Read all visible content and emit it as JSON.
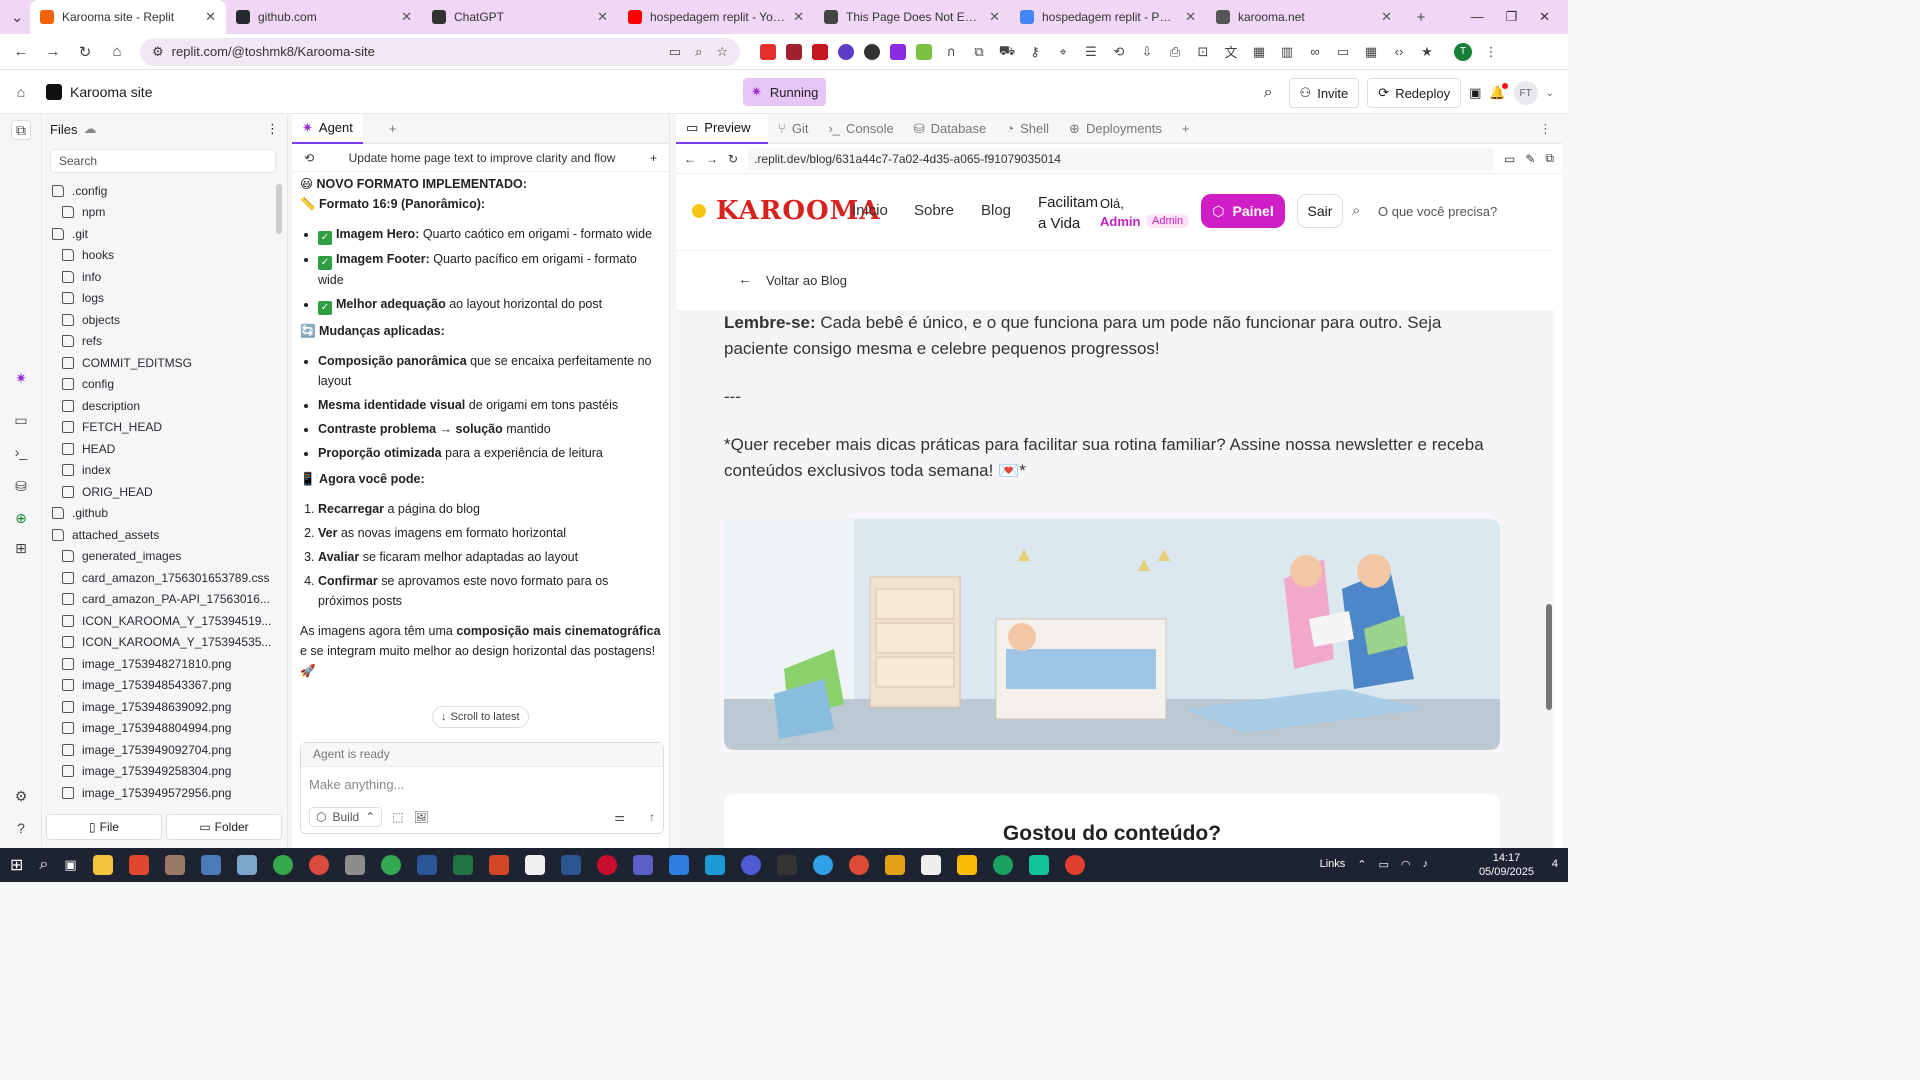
{
  "browser": {
    "tabs": [
      {
        "title": "Karooma site - Replit",
        "color": "#f26207"
      },
      {
        "title": "github.com",
        "color": "#24292f"
      },
      {
        "title": "ChatGPT",
        "color": "#333333"
      },
      {
        "title": "hospedagem replit - YouTube",
        "color": "#ff0000"
      },
      {
        "title": "This Page Does Not Exist",
        "color": "#444444"
      },
      {
        "title": "hospedagem replit - Pesquisa",
        "color": "#4285f4"
      },
      {
        "title": "karooma.net",
        "color": "#555555"
      }
    ],
    "url": "replit.com/@toshmk8/Karooma-site"
  },
  "app": {
    "project": "Karooma site",
    "running_label": "Running",
    "invite_label": "Invite",
    "redeploy_label": "Redeploy",
    "avatar_initials": "FT"
  },
  "files": {
    "title": "Files",
    "search_placeholder": "Search",
    "items": [
      {
        "name": ".config",
        "type": "folder",
        "depth": 0
      },
      {
        "name": "npm",
        "type": "folder",
        "depth": 1
      },
      {
        "name": ".git",
        "type": "folder",
        "depth": 0
      },
      {
        "name": "hooks",
        "type": "folder",
        "depth": 1
      },
      {
        "name": "info",
        "type": "folder",
        "depth": 1
      },
      {
        "name": "logs",
        "type": "folder",
        "depth": 1
      },
      {
        "name": "objects",
        "type": "folder",
        "depth": 1
      },
      {
        "name": "refs",
        "type": "folder",
        "depth": 1
      },
      {
        "name": "COMMIT_EDITMSG",
        "type": "file",
        "depth": 1
      },
      {
        "name": "config",
        "type": "file",
        "depth": 1
      },
      {
        "name": "description",
        "type": "file",
        "depth": 1
      },
      {
        "name": "FETCH_HEAD",
        "type": "file",
        "depth": 1
      },
      {
        "name": "HEAD",
        "type": "file",
        "depth": 1
      },
      {
        "name": "index",
        "type": "file",
        "depth": 1
      },
      {
        "name": "ORIG_HEAD",
        "type": "file",
        "depth": 1
      },
      {
        "name": ".github",
        "type": "folder",
        "depth": 0
      },
      {
        "name": "attached_assets",
        "type": "folder",
        "depth": 0
      },
      {
        "name": "generated_images",
        "type": "folder",
        "depth": 1
      },
      {
        "name": "card_amazon_1756301653789.css",
        "type": "file",
        "depth": 1
      },
      {
        "name": "card_amazon_PA-API_17563016...",
        "type": "file",
        "depth": 1
      },
      {
        "name": "ICON_KAROOMA_Y_175394519...",
        "type": "image",
        "depth": 1
      },
      {
        "name": "ICON_KAROOMA_Y_175394535...",
        "type": "image",
        "depth": 1
      },
      {
        "name": "image_1753948271810.png",
        "type": "image",
        "depth": 1
      },
      {
        "name": "image_1753948543367.png",
        "type": "image",
        "depth": 1
      },
      {
        "name": "image_1753948639092.png",
        "type": "image",
        "depth": 1
      },
      {
        "name": "image_1753948804994.png",
        "type": "image",
        "depth": 1
      },
      {
        "name": "image_1753949092704.png",
        "type": "image",
        "depth": 1
      },
      {
        "name": "image_1753949258304.png",
        "type": "image",
        "depth": 1
      },
      {
        "name": "image_1753949572956.png",
        "type": "image",
        "depth": 1
      }
    ],
    "file_button": "File",
    "folder_button": "Folder"
  },
  "agent": {
    "tab_label": "Agent",
    "header": "Update home page text to improve clarity and flow",
    "implemented": "NOVO FORMATO IMPLEMENTADO:",
    "format": "Formato 16:9 (Panorâmico):",
    "bullets1": [
      {
        "bold": "Imagem Hero:",
        "text": " Quarto caótico em origami - formato wide"
      },
      {
        "bold": "Imagem Footer:",
        "text": " Quarto pacífico em origami - formato wide"
      },
      {
        "bold": "Melhor adequação",
        "text": " ao layout horizontal do post"
      }
    ],
    "changes_title": "Mudanças aplicadas:",
    "bullets2": [
      {
        "bold": "Composição panorâmica",
        "text": " que se encaixa perfeitamente no layout"
      },
      {
        "bold": "Mesma identidade visual",
        "text": " de origami em tons pastéis"
      },
      {
        "bold": "Contraste problema → solução",
        "text": " mantido"
      },
      {
        "bold": "Proporção otimizada",
        "text": " para a experiência de leitura"
      }
    ],
    "now_title": "Agora você pode:",
    "steps": [
      {
        "bold": "Recarregar",
        "text": " a página do blog"
      },
      {
        "bold": "Ver",
        "text": " as novas imagens em formato horizontal"
      },
      {
        "bold": "Avaliar",
        "text": " se ficaram melhor adaptadas ao layout"
      },
      {
        "bold": "Confirmar",
        "text": " se aprovamos este novo formato para os próximos posts"
      }
    ],
    "closing_pre": "As imagens agora têm uma ",
    "closing_bold": "composição mais cinematográfica",
    "closing_post": " e se integram muito melhor ao design horizontal das postagens! 🚀",
    "scroll_latest": "Scroll to latest",
    "status": "Agent is ready",
    "input_placeholder": "Make anything...",
    "build_label": "Build"
  },
  "preview": {
    "tabs": [
      "Preview",
      "Git",
      "Console",
      "Database",
      "Shell",
      "Deployments"
    ],
    "url": ".replit.dev/blog/631a44c7-7a02-4d35-a065-f91079035014",
    "site": {
      "logo": "KAROOMA",
      "nav": [
        "Início",
        "Sobre",
        "Blog"
      ],
      "tagline_1": "Facilitam",
      "tagline_2": "a Vida",
      "hello": "Olá,",
      "user": "Admin",
      "badge": "Admin",
      "panel": "Painel",
      "logout": "Sair",
      "search_placeholder": "O que você precisa?",
      "back": "Voltar ao Blog",
      "remember_bold": "Lembre-se:",
      "remember_text": " Cada bebê é único, e o que funciona para um pode não funcionar para outro. Seja paciente consigo mesma e celebre pequenos progressos!",
      "separator": "---",
      "newsletter": "*Quer receber mais dicas práticas para facilitar sua rotina familiar? Assine nossa newsletter e receba conteúdos exclusivos toda semana! 💌*",
      "card_title": "Gostou do conteúdo?"
    }
  },
  "taskbar": {
    "links": "Links",
    "time": "14:17",
    "date": "05/09/2025",
    "notif": "4"
  }
}
